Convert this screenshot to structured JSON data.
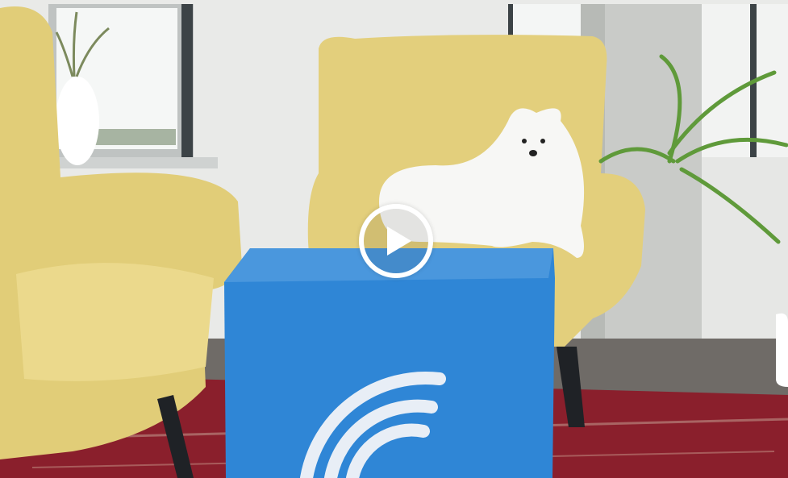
{
  "video": {
    "poster_description": "",
    "play_icon": "play-icon",
    "colors": {
      "cube": "#2f86d6",
      "chair": "#e3cf7c",
      "rug": "#8a1f2c",
      "wall": "#ecedeb"
    }
  }
}
